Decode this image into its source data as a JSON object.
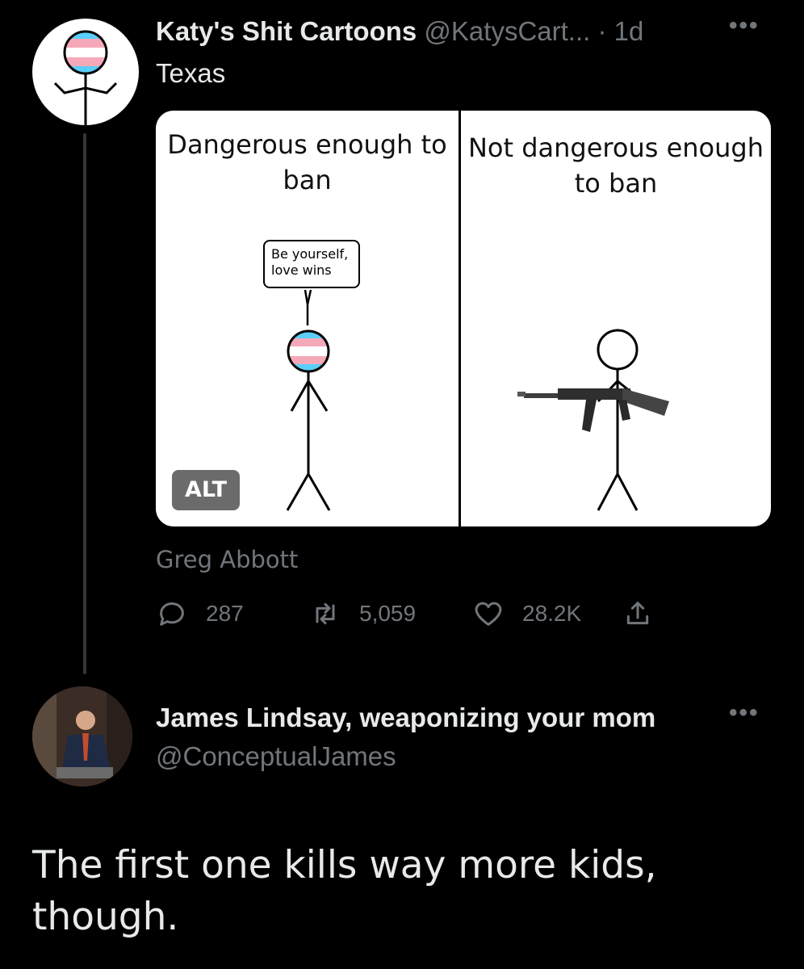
{
  "tweet1": {
    "author_name": "Katy's Shit Cartoons",
    "author_handle": "@KatysCart...",
    "time": "· 1d",
    "location": "Texas",
    "more": "•••",
    "image": {
      "left_caption": "Dangerous enough to ban",
      "right_caption": "Not dangerous enough to ban",
      "bubble_text": "Be yourself, love wins",
      "alt_badge": "ALT"
    },
    "credit": "Greg Abbott",
    "actions": {
      "replies": "287",
      "retweets": "5,059",
      "likes": "28.2K"
    },
    "colors": {
      "trans_blue": "#5bcefa",
      "trans_pink": "#f5a9b8",
      "muted": "#71767b"
    }
  },
  "tweet2": {
    "author_name": "James Lindsay, weaponizing your mom",
    "author_handle": "@ConceptualJames",
    "more": "•••",
    "text": "The first one kills way more kids, though."
  }
}
